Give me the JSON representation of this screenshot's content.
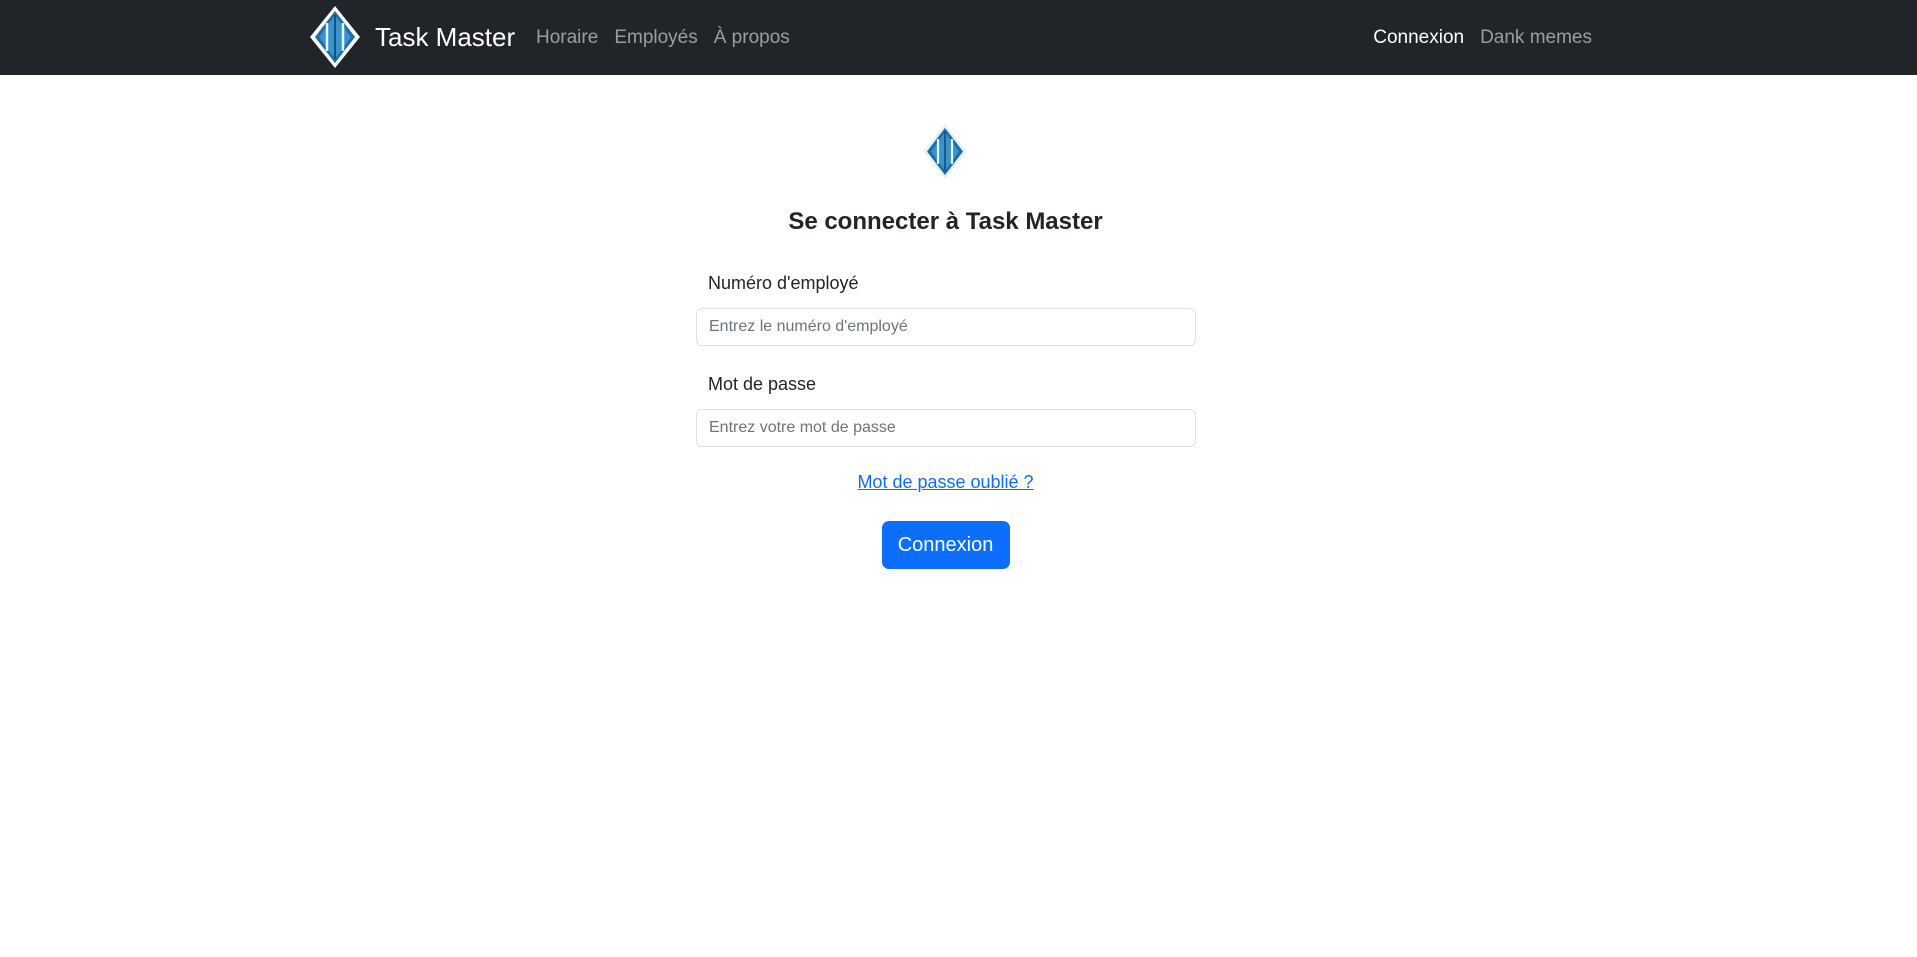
{
  "navbar": {
    "brand_title": "Task Master",
    "left_links": [
      {
        "label": "Horaire"
      },
      {
        "label": "Employés"
      },
      {
        "label": "À propos"
      }
    ],
    "right_links": [
      {
        "label": "Connexion",
        "active": true
      },
      {
        "label": "Dank memes",
        "active": false
      }
    ]
  },
  "login": {
    "heading": "Se connecter à Task Master",
    "employee_number": {
      "label": "Numéro d'employé",
      "placeholder": "Entrez le numéro d'employé",
      "value": ""
    },
    "password": {
      "label": "Mot de passe",
      "placeholder": "Entrez votre mot de passe",
      "value": ""
    },
    "forgot_password_label": "Mot de passe oublié ?",
    "submit_label": "Connexion"
  },
  "icons": {
    "brand_logo": "diamond-logo-icon",
    "page_logo": "diamond-logo-icon"
  },
  "colors": {
    "navbar_bg": "#212529",
    "primary": "#0d6efd",
    "logo_blue": "#1c6fa6",
    "nav_link_muted": "rgba(255,255,255,0.55)",
    "nav_link_active": "#ffffff"
  }
}
